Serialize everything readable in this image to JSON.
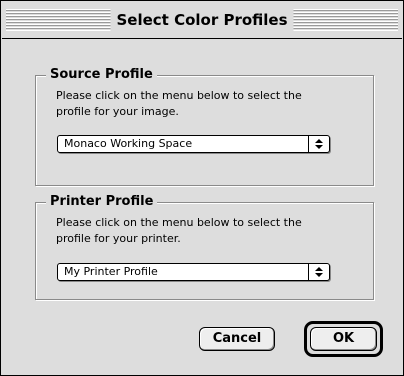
{
  "dialog": {
    "title": "Select Color Profiles"
  },
  "source_profile": {
    "heading": "Source Profile",
    "description": "Please click on the menu  below to select the\nprofile for your image.",
    "selected": "Monaco Working Space"
  },
  "printer_profile": {
    "heading": "Printer Profile",
    "description": "Please click on the menu  below to select the\nprofile for your printer.",
    "selected": "My Printer Profile"
  },
  "buttons": {
    "cancel": "Cancel",
    "ok": "OK"
  },
  "icons": {
    "popup_arrows": "up-down-arrows-icon"
  },
  "colors": {
    "window_bg": "#dddddd",
    "field_bg": "#ffffff",
    "border": "#000000"
  }
}
